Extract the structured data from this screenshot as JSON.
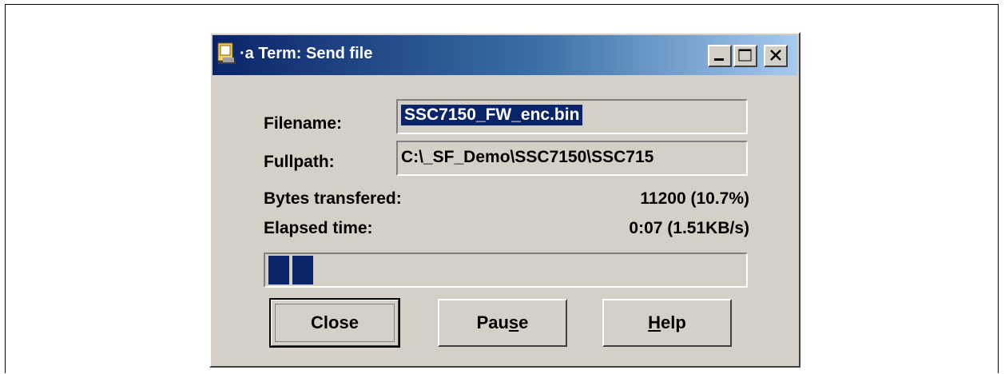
{
  "window": {
    "title": "·a Term: Send file",
    "icon": "app-icon"
  },
  "titlebar_buttons": {
    "minimize_icon": "minimize-icon",
    "maximize_icon": "maximize-icon",
    "close_icon": "close-icon"
  },
  "fields": {
    "filename_label": "Filename:",
    "filename_value": "SSC7150_FW_enc.bin",
    "fullpath_label": "Fullpath:",
    "fullpath_value": "C:\\_SF_Demo\\SSC7150\\SSC715"
  },
  "stats": {
    "bytes_label": "Bytes transfered:",
    "bytes_value": "11200 (10.7%)",
    "elapsed_label": "Elapsed time:",
    "elapsed_value": "0:07 (1.51KB/s)"
  },
  "progress": {
    "fraction": 0.107,
    "bar_color": "#0a246a"
  },
  "buttons": {
    "close_label": "Close",
    "pause_label_pre": "Pau",
    "pause_label_u": "s",
    "pause_label_post": "e",
    "help_label_u": "H",
    "help_label_post": "elp"
  },
  "colors": {
    "dialog_bg": "#d4d0c8",
    "titlebar_start": "#0a246a",
    "titlebar_end": "#a6caf0",
    "selection": "#0a246a"
  }
}
